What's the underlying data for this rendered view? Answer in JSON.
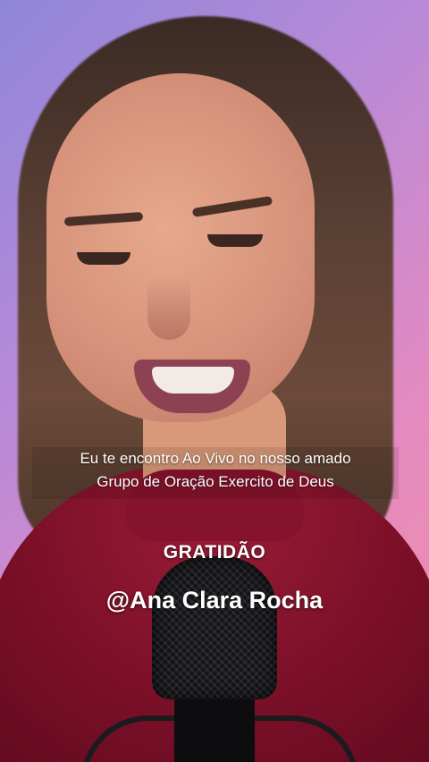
{
  "caption": {
    "line1": "Eu te encontro Ao Vivo no nosso amado",
    "line2": "Grupo de Oração Exercito de Deus"
  },
  "headline": "GRATIDÃO",
  "creator_handle": "@Ana Clara Rocha",
  "colors": {
    "background_left": "#8f86d9",
    "background_right": "#f08fa8",
    "sweater": "#7a0f28",
    "overlay_text": "#ffffff"
  }
}
